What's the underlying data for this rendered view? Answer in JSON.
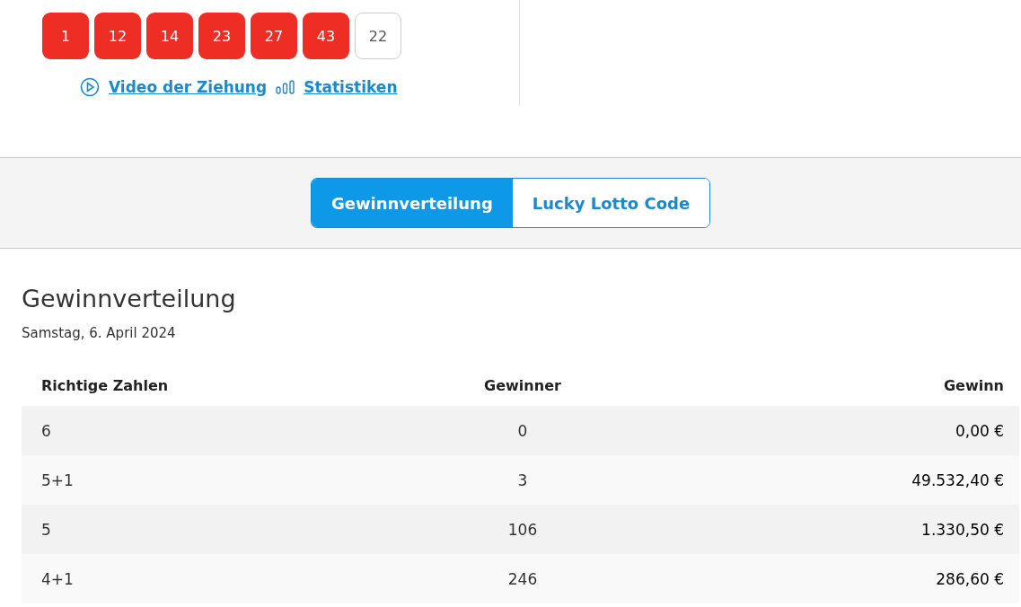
{
  "numbers": [
    {
      "value": "1",
      "kind": "main"
    },
    {
      "value": "12",
      "kind": "main"
    },
    {
      "value": "14",
      "kind": "main"
    },
    {
      "value": "23",
      "kind": "main"
    },
    {
      "value": "27",
      "kind": "main"
    },
    {
      "value": "43",
      "kind": "main"
    },
    {
      "value": "22",
      "kind": "bonus"
    }
  ],
  "links": [
    {
      "label": "Video der Ziehung",
      "kind": "video"
    },
    {
      "label": "Statistiken",
      "kind": "stats"
    }
  ],
  "tabs": [
    {
      "label": "Gewinnverteilung",
      "selected": true
    },
    {
      "label": "Lucky Lotto Code",
      "selected": false
    }
  ],
  "section": {
    "title": "Gewinnverteilung",
    "date": "Samstag, 6. April 2024"
  },
  "table": {
    "columns": [
      "Richtige Zahlen",
      "Gewinner",
      "Gewinn"
    ],
    "rows": [
      [
        "6",
        "0",
        "0,00 €"
      ],
      [
        "5+1",
        "3",
        "49.532,40 €"
      ],
      [
        "5",
        "106",
        "1.330,50 €"
      ],
      [
        "4+1",
        "246",
        "286,60 €"
      ]
    ]
  }
}
